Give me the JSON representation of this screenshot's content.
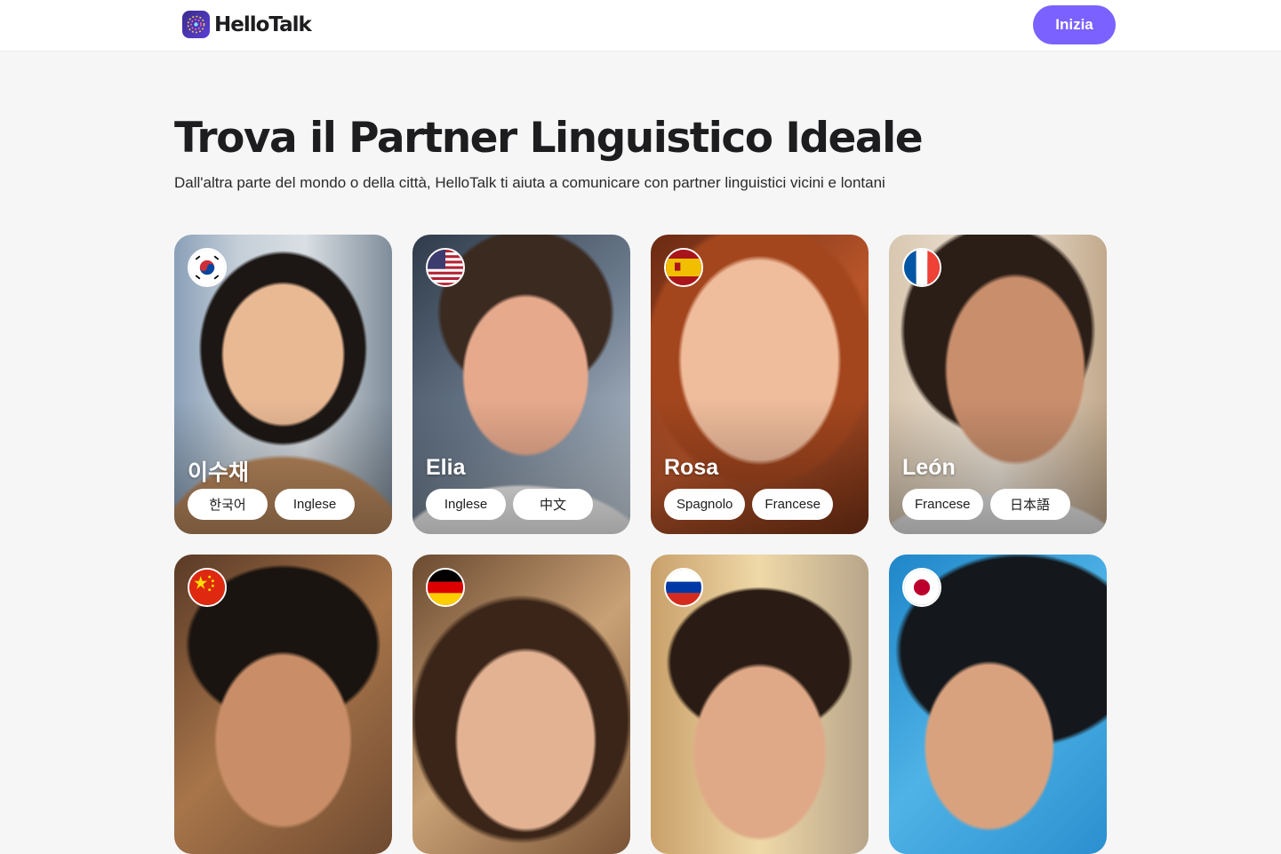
{
  "brand": {
    "name": "HelloTalk",
    "accent": "#7b61ff"
  },
  "header": {
    "cta_label": "Inizia"
  },
  "hero": {
    "title": "Trova il Partner Linguistico Ideale",
    "subtitle": "Dall'altra parte del mondo o della città, HelloTalk ti aiuta a comunicare con partner linguistici vicini e lontani"
  },
  "partners": [
    {
      "name": "이수채",
      "flag": "south-korea-flag",
      "languages": [
        "한국어",
        "Inglese"
      ]
    },
    {
      "name": "Elia",
      "flag": "usa-flag",
      "languages": [
        "Inglese",
        "中文"
      ]
    },
    {
      "name": "Rosa",
      "flag": "spain-flag",
      "languages": [
        "Spagnolo",
        "Francese"
      ]
    },
    {
      "name": "León",
      "flag": "france-flag",
      "languages": [
        "Francese",
        "日本語"
      ]
    },
    {
      "name": "",
      "flag": "china-flag",
      "languages": []
    },
    {
      "name": "",
      "flag": "germany-flag",
      "languages": []
    },
    {
      "name": "",
      "flag": "russia-flag",
      "languages": []
    },
    {
      "name": "",
      "flag": "japan-flag",
      "languages": []
    }
  ]
}
